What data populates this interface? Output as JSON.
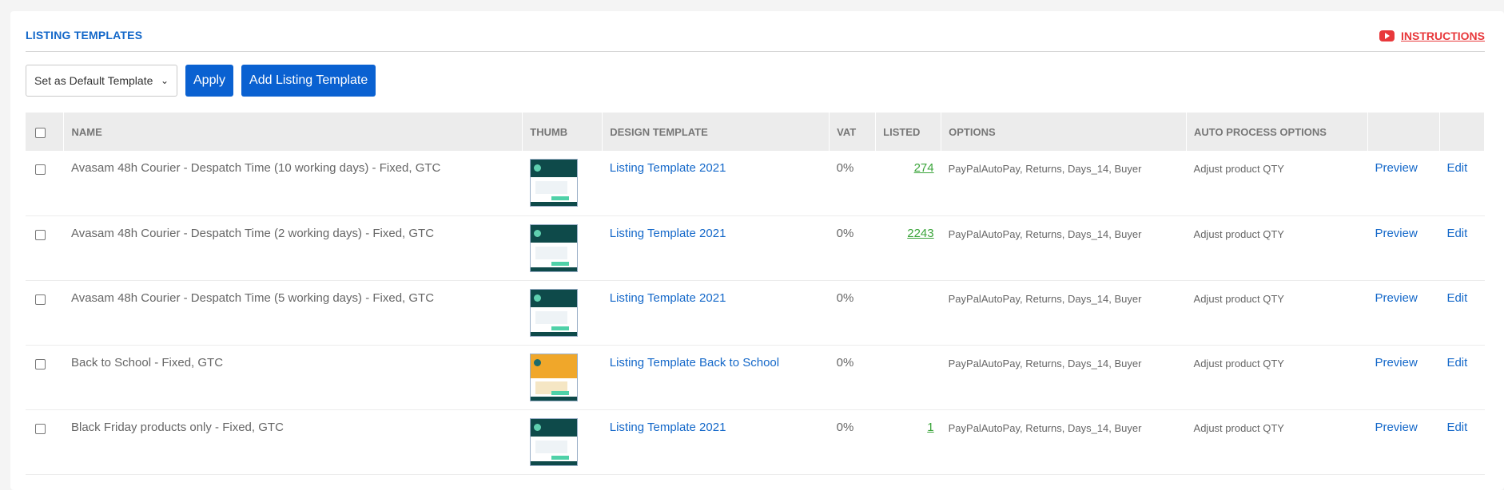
{
  "header": {
    "title": "LISTING TEMPLATES",
    "instructions_label": "INSTRUCTIONS"
  },
  "toolbar": {
    "select_value": "Set as Default Template",
    "apply_label": "Apply",
    "add_label": "Add Listing Template"
  },
  "table": {
    "columns": [
      "NAME",
      "THUMB",
      "DESIGN TEMPLATE",
      "VAT",
      "LISTED",
      "OPTIONS",
      "AUTO PROCESS OPTIONS",
      "",
      ""
    ],
    "rows": [
      {
        "name": "Avasam 48h Courier - Despatch Time (10 working days) - Fixed, GTC",
        "design": "Listing Template 2021",
        "vat": "0%",
        "listed": "274",
        "options": "PayPalAutoPay, Returns, Days_14, Buyer",
        "auto": "Adjust product QTY",
        "preview": "Preview",
        "edit": "Edit"
      },
      {
        "name": "Avasam 48h Courier - Despatch Time (2 working days) - Fixed, GTC",
        "design": "Listing Template 2021",
        "vat": "0%",
        "listed": "2243",
        "options": "PayPalAutoPay, Returns, Days_14, Buyer",
        "auto": "Adjust product QTY",
        "preview": "Preview",
        "edit": "Edit"
      },
      {
        "name": "Avasam 48h Courier - Despatch Time (5 working days) - Fixed, GTC",
        "design": "Listing Template 2021",
        "vat": "0%",
        "listed": "",
        "options": "PayPalAutoPay, Returns, Days_14, Buyer",
        "auto": "Adjust product QTY",
        "preview": "Preview",
        "edit": "Edit"
      },
      {
        "name": "Back to School - Fixed, GTC",
        "design": "Listing Template Back to School",
        "vat": "0%",
        "listed": "",
        "options": "PayPalAutoPay, Returns, Days_14, Buyer",
        "auto": "Adjust product QTY",
        "preview": "Preview",
        "edit": "Edit"
      },
      {
        "name": "Black Friday products only - Fixed, GTC",
        "design": "Listing Template 2021",
        "vat": "0%",
        "listed": "1",
        "options": "PayPalAutoPay, Returns, Days_14, Buyer",
        "auto": "Adjust product QTY",
        "preview": "Preview",
        "edit": "Edit"
      }
    ]
  },
  "colors": {
    "accent": "#0a61d1",
    "link": "#1468c9",
    "listed": "#3aa43a",
    "instructions": "#e8383b"
  }
}
